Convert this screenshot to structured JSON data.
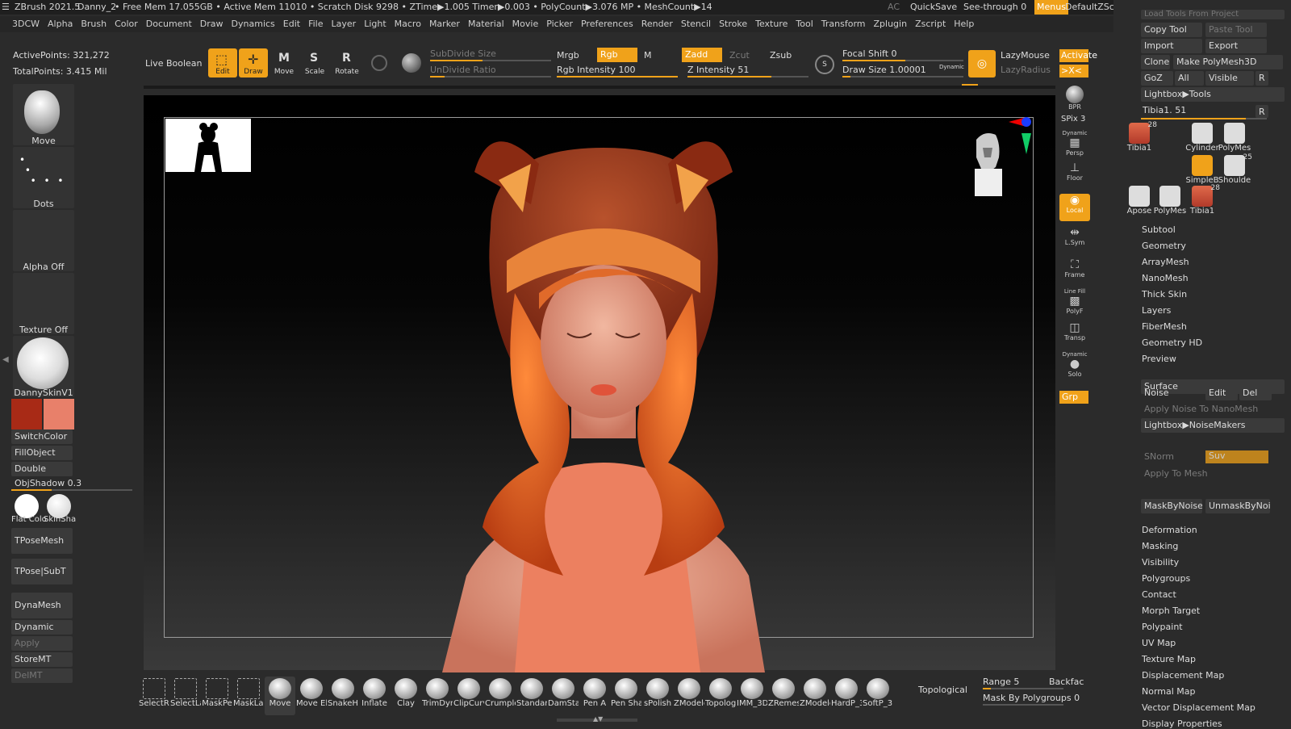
{
  "titlebar": {
    "app": "ZBrush 2021.5",
    "doc": "Danny_2",
    "stats": "• Free Mem 17.055GB • Active Mem 11010 • Scratch Disk 9298 • ZTime▶1.005 Timer▶0.003 • PolyCount▶3.076 MP • MeshCount▶14",
    "ac": "AC",
    "quicksave": "QuickSave",
    "seethrough": "See-through",
    "seethrough_val": "0",
    "menus": "Menus",
    "script": "DefaultZScript"
  },
  "menus": [
    "3DCW",
    "Alpha",
    "Brush",
    "Color",
    "Document",
    "Draw",
    "Dynamics",
    "Edit",
    "File",
    "Layer",
    "Light",
    "Macro",
    "Marker",
    "Material",
    "Movie",
    "Picker",
    "Preferences",
    "Render",
    "Stencil",
    "Stroke",
    "Texture",
    "Tool",
    "Transform",
    "Zplugin",
    "Zscript",
    "Help"
  ],
  "info": {
    "active_points": "ActivePoints: 321,272",
    "total_points": "TotalPoints: 3.415 Mil"
  },
  "toolbar": {
    "live_boolean": "Live Boolean",
    "edit": "Edit",
    "draw": "Draw",
    "move": "Move",
    "scale": "Scale",
    "rotate": "Rotate",
    "subdivide_size": "SubDivide Size",
    "undivide_ratio": "UnDivide Ratio",
    "mrgb": "Mrgb",
    "rgb": "Rgb",
    "m": "M",
    "rgb_intensity": "Rgb Intensity 100",
    "zadd": "Zadd",
    "zcut": "Zcut",
    "zsub": "Zsub",
    "z_intensity": "Z Intensity 51",
    "focal_shift": "Focal Shift 0",
    "draw_size": "Draw Size 1.00001",
    "dynamic": "Dynamic",
    "lazymouse": "LazyMouse",
    "lazyradius": "LazyRadius",
    "activate": "Activate",
    "xpose": ">X<"
  },
  "left": {
    "brush": "Move",
    "stroke": "Dots",
    "alpha": "Alpha Off",
    "texture": "Texture Off",
    "material": "DannySkinV1",
    "main_color": "#a82a16",
    "secondary_color": "#e8806a",
    "switch_color": "SwitchColor",
    "fill_object": "FillObject",
    "double": "Double",
    "objshadow": "ObjShadow",
    "objshadow_val": "0.3",
    "flat_color": "Flat Colo",
    "skin_shade": "SkinSha",
    "tpose_mesh": "TPoseMesh",
    "tpose_subt": "TPose|SubT",
    "dynamesh": "DynaMesh",
    "dynamic": "Dynamic",
    "apply": "Apply",
    "storemt": "StoreMT",
    "delmt": "DelMT"
  },
  "rightshelf": {
    "bpr": "BPR",
    "spix": "SPix 3",
    "persp": "Persp",
    "floor": "Floor",
    "local": "Local",
    "lsym": "L.Sym",
    "frame": "Frame",
    "polyf": "PolyF",
    "transp": "Transp",
    "solo": "Solo",
    "grp": "Grp",
    "dynamic": "Dynamic",
    "line_fill": "Line Fill"
  },
  "tool_panel": {
    "load_project": "Load Tools From Project",
    "copy_tool": "Copy Tool",
    "paste_tool": "Paste Tool",
    "import": "Import",
    "export": "Export",
    "clone": "Clone",
    "make_polymesh": "Make PolyMesh3D",
    "goz": "GoZ",
    "all": "All",
    "visible": "Visible",
    "r": "R",
    "lightbox_tools": "Lightbox▶Tools",
    "tool_name": "Tibia1. 51",
    "tools": [
      {
        "name": "Tibia1",
        "count": "28"
      },
      {
        "name": "Cylinder"
      },
      {
        "name": "PolyMes"
      },
      {
        "name": "SimpleB"
      },
      {
        "name": "Shoulde",
        "count": "25"
      },
      {
        "name": "Apose"
      },
      {
        "name": "PolyMes"
      },
      {
        "name": "Tibia1",
        "count": "28"
      }
    ],
    "sections": [
      "Subtool",
      "Geometry",
      "ArrayMesh",
      "NanoMesh",
      "Thick Skin",
      "Layers",
      "FiberMesh",
      "Geometry HD",
      "Preview",
      "Surface"
    ],
    "noise": "Noise",
    "edit": "Edit",
    "del": "Del",
    "apply_noise_nano": "Apply Noise To NanoMesh",
    "lightbox_noise": "Lightbox▶NoiseMakers",
    "snorm": "SNorm",
    "suv": "Suv",
    "apply_to_mesh": "Apply To Mesh",
    "mask_by_noise": "MaskByNoise",
    "unmask_by_noise": "UnmaskByNoise",
    "sections2": [
      "Deformation",
      "Masking",
      "Visibility",
      "Polygroups",
      "Contact",
      "Morph Target",
      "Polypaint",
      "UV Map",
      "Texture Map",
      "Displacement Map",
      "Normal Map",
      "Vector Displacement Map",
      "Display Properties"
    ]
  },
  "bottom": {
    "brushes": [
      "SelectRe",
      "SelectLa",
      "MaskPe",
      "MaskLas",
      "Move",
      "Move El",
      "SnakeHo",
      "Inflate",
      "Clay",
      "TrimDyn",
      "ClipCurv",
      "Crumple",
      "Standar",
      "DamSta",
      "Pen A",
      "Pen Sha",
      "sPolish",
      "ZModele",
      "Topolog",
      "IMM_3D",
      "ZRemes",
      "ZModele",
      "HardP_3",
      "SoftP_3D"
    ],
    "topological": "Topological",
    "range": "Range 5",
    "backface": "Backfac",
    "mask_polygroups": "Mask By Polygroups 0"
  }
}
